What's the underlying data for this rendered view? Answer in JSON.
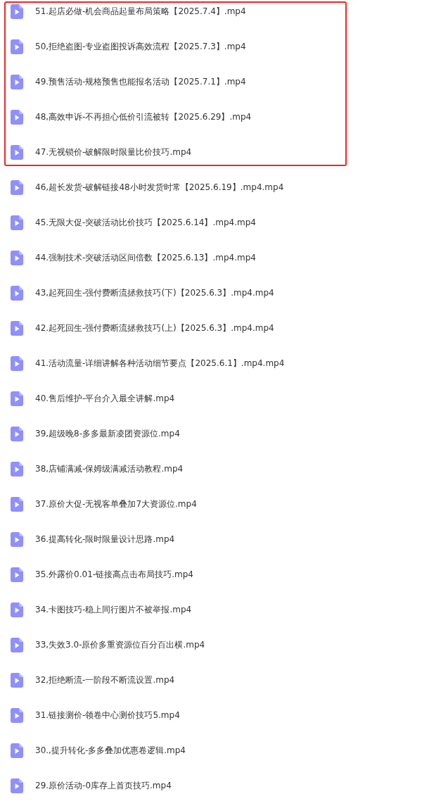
{
  "highlighted_files": [
    {
      "name": "51.起店必做-机会商品起量布局策略【2025.7.4】.mp4"
    },
    {
      "name": "50,拒绝盗图-专业盗图投诉高效流程【2025.7.3】.mp4"
    },
    {
      "name": "49.预售活动-规格预售也能报名活动【2025.7.1】.mp4"
    },
    {
      "name": "48,高效申诉-不再担心低价引流被转【2025.6.29】.mp4"
    },
    {
      "name": "47.无视锁价-破解限时限量比价技巧.mp4"
    }
  ],
  "files": [
    {
      "name": "46,超长发货-破解链接48小时发货时常【2025.6.19】.mp4.mp4"
    },
    {
      "name": "45.无限大促-突破活动比价技巧【2025.6.14】.mp4.mp4"
    },
    {
      "name": "44.强制技术-突破活动区间倍数【2025.6.13】.mp4.mp4"
    },
    {
      "name": "43,起死回生-强付费断流拯救技巧(下)【2025.6.3】.mp4.mp4"
    },
    {
      "name": "42.起死回生-强付费断流拯救技巧(上)【2025.6.3】.mp4.mp4"
    },
    {
      "name": "41.活动流量-详细讲解各种活动细节要点【2025.6.1】.mp4.mp4"
    },
    {
      "name": "40.售后维护-平台介入最全讲解.mp4"
    },
    {
      "name": "39,超级晚8-多多最新凌团资源位.mp4"
    },
    {
      "name": "38,店铺满减-保姆级满减活动教程.mp4"
    },
    {
      "name": "37.原价大促-无视客单叠加7大资源位.mp4"
    },
    {
      "name": "36.提高转化-限时限量设计思路.mp4"
    },
    {
      "name": "35.外露价0.01-链接高点击布局技巧.mp4"
    },
    {
      "name": "34.卡图技巧-稳上同行图片不被举报.mp4"
    },
    {
      "name": "33,失效3.0-原价多重资源位百分百出横.mp4"
    },
    {
      "name": "32,拒绝断流-一阶段不断流设置.mp4"
    },
    {
      "name": "31.链接测价-领卷中心测价技巧5.mp4"
    },
    {
      "name": "30.,提升转化-多多叠加优惠卷逻辑.mp4"
    },
    {
      "name": "29.原价活动-0库存上首页技巧.mp4"
    }
  ]
}
